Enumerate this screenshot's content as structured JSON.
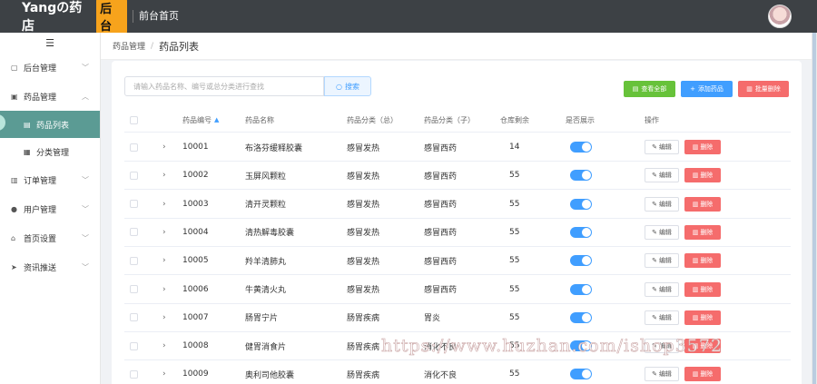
{
  "header": {
    "logo_text": "Yangの药店",
    "logo_badge": "后台",
    "front_link": "前台首页",
    "accent": "#f7a31c"
  },
  "sidebar": {
    "toggle_icon": "menu-icon",
    "items": [
      {
        "label": "后台管理",
        "icon": "home-icon"
      },
      {
        "label": "药品管理",
        "icon": "bag-icon",
        "expanded": true,
        "children": [
          {
            "label": "药品列表",
            "active": true
          },
          {
            "label": "分类管理"
          }
        ]
      },
      {
        "label": "订单管理",
        "icon": "order-icon"
      },
      {
        "label": "用户管理",
        "icon": "user-icon"
      },
      {
        "label": "首页设置",
        "icon": "house-icon"
      },
      {
        "label": "资讯推送",
        "icon": "send-icon"
      }
    ]
  },
  "breadcrumb": {
    "parent": "药品管理",
    "current": "药品列表"
  },
  "toolbar": {
    "search_placeholder": "请输入药品名称、编号或总分类进行查找",
    "search_label": "搜索",
    "view_all_label": "查看全部",
    "add_label": "添加药品",
    "batch_delete_label": "批量删除"
  },
  "table": {
    "columns": [
      "药品编号",
      "药品名称",
      "药品分类（总）",
      "药品分类（子）",
      "仓库剩余",
      "是否展示",
      "操作"
    ],
    "edit_label": "编辑",
    "delete_label": "删除",
    "rows": [
      {
        "id": "10001",
        "name": "布洛芬缓释胶囊",
        "cat": "感冒发热",
        "sub": "感冒西药",
        "stock": "14",
        "show": true
      },
      {
        "id": "10002",
        "name": "玉屏风颗粒",
        "cat": "感冒发热",
        "sub": "感冒西药",
        "stock": "55",
        "show": true
      },
      {
        "id": "10003",
        "name": "清开灵颗粒",
        "cat": "感冒发热",
        "sub": "感冒西药",
        "stock": "55",
        "show": true
      },
      {
        "id": "10004",
        "name": "清热解毒胶囊",
        "cat": "感冒发热",
        "sub": "感冒西药",
        "stock": "55",
        "show": true
      },
      {
        "id": "10005",
        "name": "羚羊清肺丸",
        "cat": "感冒发热",
        "sub": "感冒西药",
        "stock": "55",
        "show": true
      },
      {
        "id": "10006",
        "name": "牛黄清火丸",
        "cat": "感冒发热",
        "sub": "感冒西药",
        "stock": "55",
        "show": true
      },
      {
        "id": "10007",
        "name": "肠胃宁片",
        "cat": "肠胃疾病",
        "sub": "胃炎",
        "stock": "55",
        "show": true
      },
      {
        "id": "10008",
        "name": "健胃消食片",
        "cat": "肠胃疾病",
        "sub": "消化不良",
        "stock": "55",
        "show": true
      },
      {
        "id": "10009",
        "name": "奥利司他胶囊",
        "cat": "肠胃疾病",
        "sub": "消化不良",
        "stock": "55",
        "show": true
      }
    ]
  },
  "watermark": "https://www.huzhan.com/ishop3572"
}
